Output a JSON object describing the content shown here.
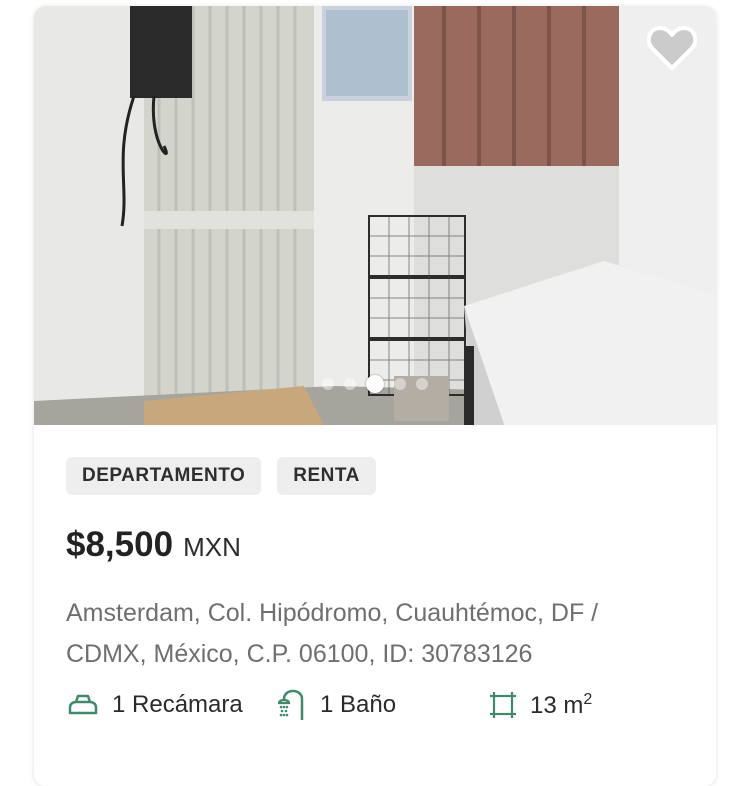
{
  "listing": {
    "tags": [
      "DEPARTAMENTO",
      "RENTA"
    ],
    "price": "$8,500",
    "currency": "MXN",
    "address": "Amsterdam, Col. Hipódromo, Cuauhtémoc, DF / CDMX, México, C.P. 06100, ID: 30783126",
    "features": {
      "bedrooms": "1 Recámara",
      "bathrooms": "1 Baño",
      "area_value": "13 m",
      "area_exp": "2"
    }
  },
  "carousel": {
    "dot_count": 5,
    "active_index": 2
  },
  "icons": {
    "favorite": "heart-icon",
    "bedroom": "bed-icon",
    "bathroom": "shower-icon",
    "area": "area-icon"
  },
  "colors": {
    "accent_green": "#3f8a6a",
    "price_text": "#222222",
    "address_text": "#6f6f6f",
    "tag_background": "#eeeeee"
  }
}
